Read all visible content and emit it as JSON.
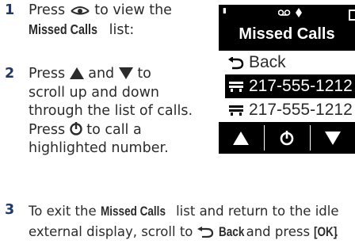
{
  "steps": [
    {
      "number": "1",
      "line1_a": "Press",
      "line1_b": "to view the",
      "line2_term": "Missed Calls",
      "line2_b": "list:"
    },
    {
      "number": "2",
      "line1_a": "Press",
      "line1_b": "and",
      "line1_c": "to",
      "line2": "scroll up and down",
      "line3": "through the list of calls.",
      "line4_a": "Press",
      "line4_b": "to call a",
      "line5": "highlighted number."
    },
    {
      "number": "3",
      "line1_a": "To exit the",
      "line1_term": "Missed Calls",
      "line1_b": "list and return to the idle",
      "line2_a": "external display, scroll to",
      "line2_term": "Back",
      "line2_b": "and press",
      "line2_key": "[OK]",
      "line2_end": "."
    }
  ],
  "phone": {
    "title": "Missed Calls",
    "back_label": "Back",
    "calls": [
      {
        "number": "217-555-1212 ...",
        "selected": true
      },
      {
        "number": "217-555-1212 ...",
        "selected": false
      }
    ],
    "status_icons": [
      "signal-icon",
      "voicemail-icon",
      "network-icon",
      "battery-icon"
    ],
    "softkeys": [
      "up-arrow-icon",
      "call-icon",
      "down-arrow-icon"
    ]
  },
  "colors": {
    "step_number": "#1f3a68",
    "text": "#2b2b2b",
    "display_dark": "#000000"
  }
}
